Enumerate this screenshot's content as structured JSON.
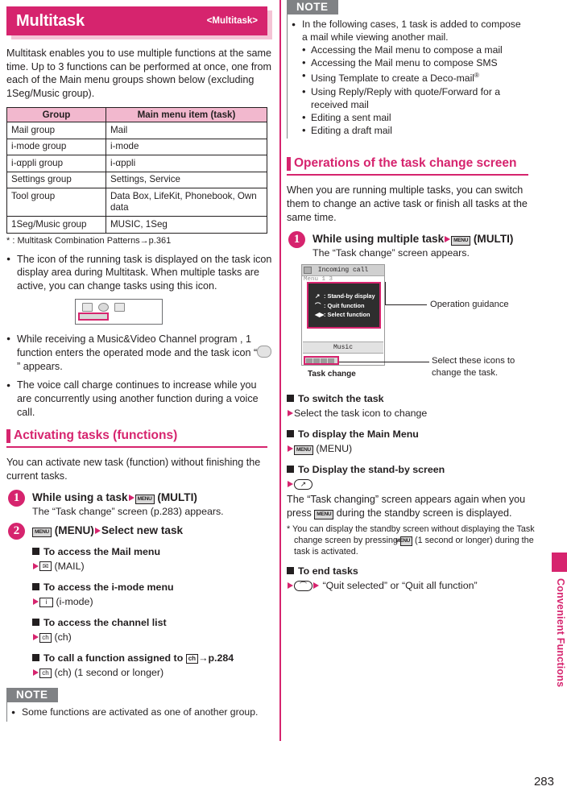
{
  "chapter": {
    "title": "Multitask",
    "tag": "<Multitask>"
  },
  "left": {
    "intro": "Multitask enables you to use multiple functions at the same time. Up to 3 functions can be performed at once, one from each of the Main menu groups shown below (excluding 1Seg/Music group).",
    "table": {
      "headers": [
        "Group",
        "Main menu item (task)"
      ],
      "rows": [
        [
          "Mail group",
          "Mail"
        ],
        [
          "i-mode group",
          "i-mode"
        ],
        [
          "i-αppli group",
          "i-αppli"
        ],
        [
          "Settings group",
          "Settings, Service"
        ],
        [
          "Tool group",
          "Data Box, LifeKit, Phonebook, Own data"
        ],
        [
          "1Seg/Music group",
          "MUSIC, 1Seg"
        ]
      ]
    },
    "footnote": "* : Multitask Combination Patterns→p.361",
    "bullets": [
      "The icon of the running task is displayed on the task icon display area during Multitask. When multiple tasks are active, you can change tasks using this icon.",
      "The voice call charge continues to increase while you are concurrently using another function during a voice call."
    ],
    "music_bullet_pre": "While receiving a Music&Video Channel program , 1 function enters the operated mode and the task icon “",
    "music_bullet_post": "” appears.",
    "section_heading": "Activating tasks (functions)",
    "section_intro": "You can activate new task (function) without finishing the current tasks.",
    "step1": {
      "number": "1",
      "title_a": "While using a task",
      "key": "MENU",
      "title_b": "(MULTI)",
      "desc": "The “Task change” screen (p.283) appears."
    },
    "step2": {
      "number": "2",
      "key": "MENU",
      "title_a": "(MENU)",
      "title_b": "Select new task",
      "subs": [
        {
          "head": "To access the Mail menu",
          "key": "✉",
          "keyclass": "key-mail",
          "label": "(MAIL)"
        },
        {
          "head": "To access the i-mode menu",
          "key": "i",
          "keyclass": "key-imode",
          "label": "(i-mode)"
        },
        {
          "head": "To access the channel list",
          "key": "ch",
          "keyclass": "",
          "label": "(ch)"
        }
      ],
      "sub4_head_a": "To call a function assigned to",
      "sub4_key": "ch",
      "sub4_head_b": "→p.284",
      "sub4_key2": "ch",
      "sub4_label": "(ch) (1 second or longer)"
    },
    "note": {
      "tag": "NOTE",
      "items": [
        "Some functions are activated as one of another group."
      ]
    }
  },
  "right": {
    "note": {
      "tag": "NOTE",
      "lead": "In the following cases, 1 task is added to compose a mail while viewing another mail.",
      "items": [
        "Accessing the Mail menu to compose a mail",
        "Accessing the Mail menu to compose SMS",
        "Using Template to create a Deco-mail",
        "Using Reply/Reply with quote/Forward for a received mail",
        "Editing a sent mail",
        "Editing a draft mail"
      ],
      "deco_sup": "®"
    },
    "section_heading": "Operations of the task change screen",
    "section_intro": "When you are running multiple tasks, you can switch them to change an active task or finish all tasks at the same time.",
    "step1": {
      "number": "1",
      "title_a": "While using multiple task",
      "key": "MENU",
      "title_b": "(MULTI)",
      "desc": "The “Task change” screen appears."
    },
    "mock": {
      "title": "Incoming call",
      "menu": "Menu 1 3",
      "guide": [
        {
          "icon": "↗",
          "text": ": Stand-by display"
        },
        {
          "icon": "⌒",
          "text": ": Quit function"
        },
        {
          "icon": "◀▶",
          "text": ": Select function"
        }
      ],
      "music": "Music",
      "caption": "Task change",
      "callout_guidance": "Operation guidance",
      "callout_icons": "Select these icons to change the task."
    },
    "subs": [
      {
        "head": "To switch the task",
        "line": "Select the task icon to change"
      },
      {
        "head": "To display the Main Menu",
        "line": "(MENU)",
        "key": "MENU"
      },
      {
        "head": "To Display the stand-by screen",
        "line": "",
        "key": "call"
      }
    ],
    "after_text_a": "The “Task changing” screen appears again when you press",
    "after_key": "MENU",
    "after_text_b": "during the standby screen is displayed.",
    "footnote_a": "* You can display the standby screen without displaying the Task change screen by pressing",
    "footnote_key": "MENU",
    "footnote_b": "(1 second or longer) during the task is activated.",
    "end_head": "To end tasks",
    "end_line": "“Quit selected” or “Quit all function”"
  },
  "sidebar": {
    "label": "Convenient Functions"
  },
  "page_number": "283",
  "colors": {
    "accent": "#d6246e",
    "accent_light": "#f2b8ce",
    "note_gray": "#808285"
  }
}
